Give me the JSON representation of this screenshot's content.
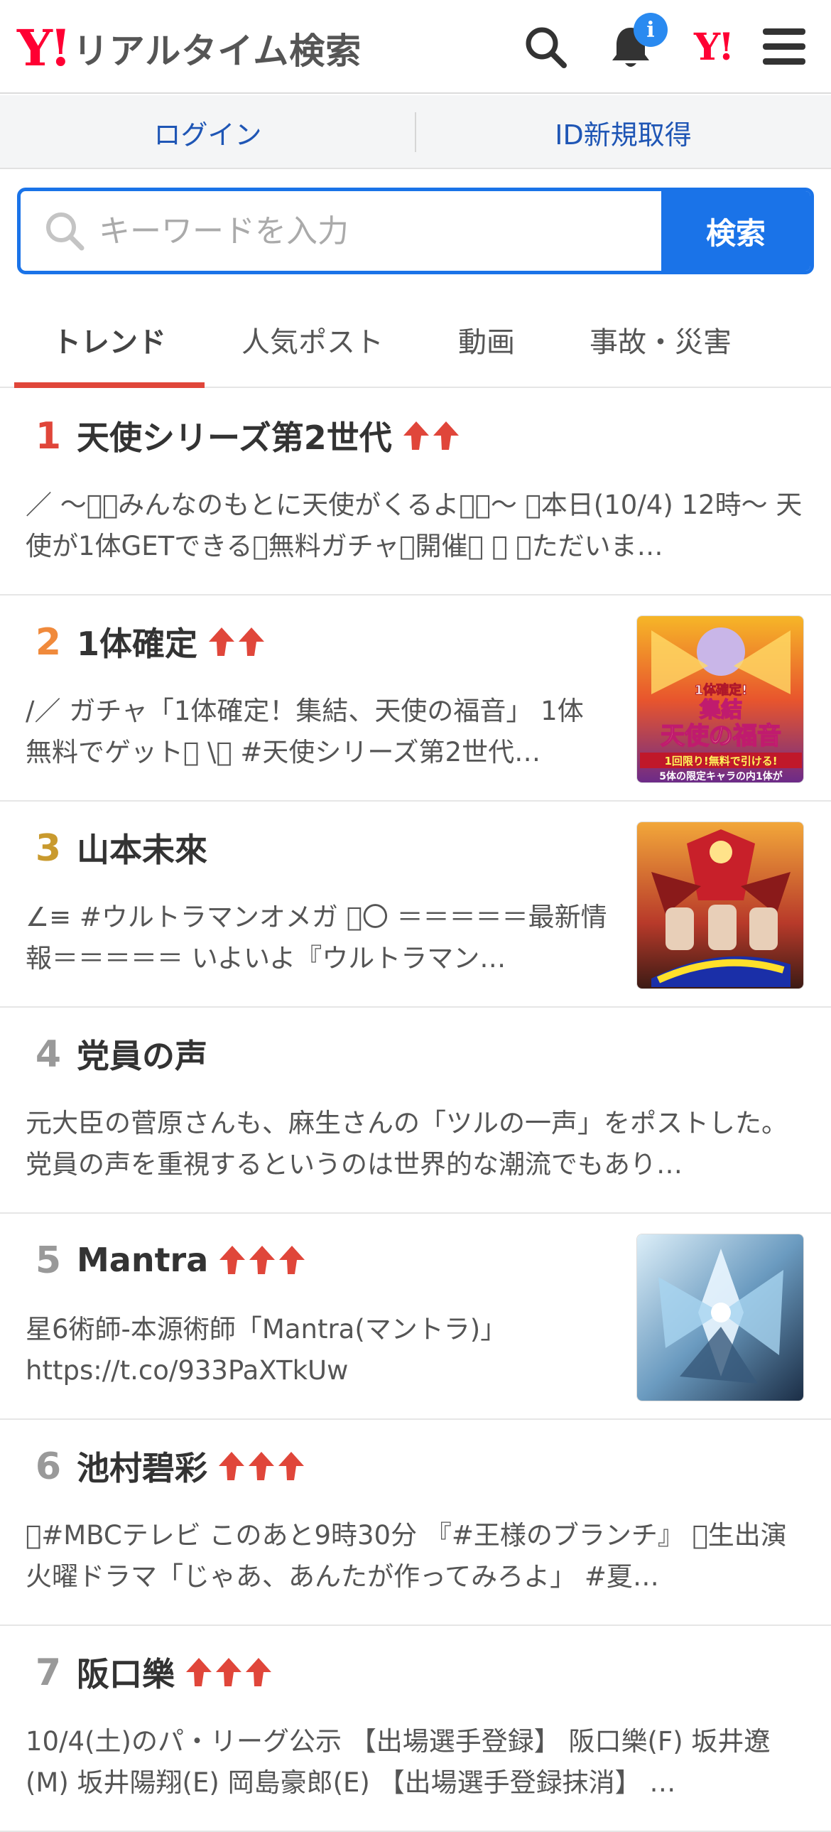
{
  "header": {
    "logo_mark": "Y!",
    "logo_text": "リアルタイム検索",
    "notification_badge": "i",
    "yahoo_mark": "Y!"
  },
  "account": {
    "login_label": "ログイン",
    "register_label": "ID新規取得"
  },
  "search": {
    "placeholder": "キーワードを入力",
    "button_label": "検索"
  },
  "tabs": [
    {
      "label": "トレンド",
      "active": true
    },
    {
      "label": "人気ポスト",
      "active": false
    },
    {
      "label": "動画",
      "active": false
    },
    {
      "label": "事故・災害",
      "active": false
    }
  ],
  "trends": [
    {
      "rank": "1",
      "title": "天使シリーズ第2世代",
      "arrows": 2,
      "rank_color": "#e0463a",
      "has_thumb": false,
      "desc": "／ 〜􀀀􀀀みんなのもとに天使がくるよ􀀀􀀀〜 􀀀本日(10/4) 12時〜 天使が1体GETできる􀀀無料ガチャ􀀀開催􀀀 ＼ 􀀀ただいま…"
    },
    {
      "rank": "2",
      "title": "1体確定",
      "arrows": 2,
      "rank_color": "#f08a3c",
      "has_thumb": true,
      "desc": "/／ ガチャ「1体確定！集結、天使の福音」 1体無料でゲット􀀀 \\＼ #天使シリーズ第2世代…"
    },
    {
      "rank": "3",
      "title": "山本未來",
      "arrows": 0,
      "rank_color": "#c99a2e",
      "has_thumb": true,
      "desc": "∠≡ #ウルトラマンオメガ 􀀀〇 ＝＝＝＝＝最新情報＝＝＝＝＝ いよいよ『ウルトラマン…"
    },
    {
      "rank": "4",
      "title": "党員の声",
      "arrows": 0,
      "rank_color": "#999999",
      "has_thumb": false,
      "desc": "元大臣の菅原さんも、麻生さんの「ツルの一声」をポストした。党員の声を重視するというのは世界的な潮流でもあり…"
    },
    {
      "rank": "5",
      "title": "Mantra",
      "arrows": 3,
      "rank_color": "#999999",
      "has_thumb": true,
      "desc": "星6術師-本源術師「Mantra(マントラ)」 https://t.co/933PaXTkUw"
    },
    {
      "rank": "6",
      "title": "池村碧彩",
      "arrows": 3,
      "rank_color": "#999999",
      "has_thumb": false,
      "desc": "􀀀#MBCテレビ このあと9時30分 『#王様のブランチ』 􀀀生出演 火曜ドラマ「じゃあ、あんたが作ってみろよ」 #夏…"
    },
    {
      "rank": "7",
      "title": "阪口樂",
      "arrows": 3,
      "rank_color": "#999999",
      "has_thumb": false,
      "desc": "10/4(土)のパ・リーグ公示 【出場選手登録】 阪口樂(F) 坂井遼(M) 坂井陽翔(E) 岡島豪郎(E) 【出場選手登録抹消】 …"
    }
  ],
  "thumb_texts": {
    "item2_line1": "1体確定!",
    "item2_line2": "集結",
    "item2_line3": "天使の福音",
    "item2_line4": "1回限り!無料で引ける!",
    "item2_line5": "5体の限定キャラの内1体が"
  },
  "colors": {
    "accent_blue": "#1a73e8",
    "tab_underline": "#e0463a",
    "arrow_red": "#e0463a"
  }
}
